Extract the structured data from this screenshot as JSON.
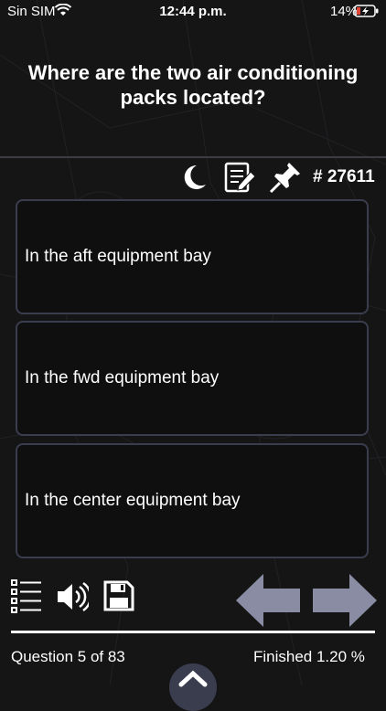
{
  "status_bar": {
    "carrier": "Sin SIM",
    "time": "12:44 p.m.",
    "battery_percent": "14%",
    "icons": [
      "wifi-icon",
      "battery-charging-icon"
    ]
  },
  "question": {
    "text": "Where are the two air conditioning packs located?"
  },
  "toolbar": {
    "icons": [
      "moon-icon",
      "notes-icon",
      "pin-icon"
    ],
    "question_id": "# 27611"
  },
  "answers": [
    {
      "label": "In the aft equipment bay"
    },
    {
      "label": "In the fwd equipment bay"
    },
    {
      "label": "In the center equipment bay"
    }
  ],
  "bottom_bar": {
    "icons": [
      "list-icon",
      "speaker-icon",
      "save-icon",
      "previous-arrow-icon",
      "next-arrow-icon",
      "chevron-up-icon"
    ],
    "question_counter": "Question 5 of 83",
    "finished_label": "Finished 1.20 %",
    "progress_fraction": 0.012
  },
  "colors": {
    "background": "#151515",
    "card_border": "#3a3d4e",
    "arrow": "#8a8ca3",
    "text": "#ffffff"
  }
}
